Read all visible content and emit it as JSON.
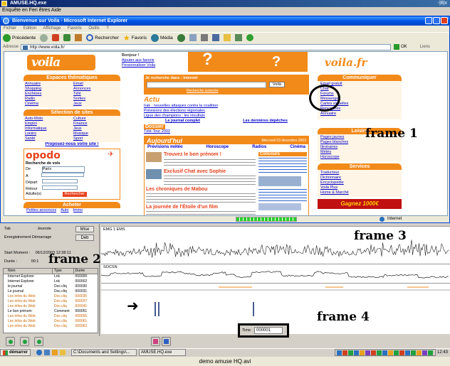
{
  "window": {
    "title": "AMUSE.HQ.exe",
    "menu": "Enquête en Fen êtres Aide",
    "win_ctrl": "-|8|x"
  },
  "browser": {
    "title": "Bienvenue sur Voila - Microsoft Internet Explorer",
    "menu": [
      "Fichier",
      "Edition",
      "Affichage",
      "Favoris",
      "Outils",
      "?"
    ],
    "toolbar": {
      "back": "Précédente",
      "search": "Rechercher",
      "favorites": "Favoris",
      "media": "Média"
    },
    "address_label": "Adresse",
    "address_value": "http://www.voila.fr/",
    "go_label": "OK",
    "links_label": "Liens"
  },
  "page": {
    "logo": "voila",
    "logo_right": "voila.fr",
    "top_links": [
      "Bonjour !",
      "Ajouter aux favoris",
      "Personnaliser Voila"
    ],
    "search_head": "Je recherche dans : Internet",
    "search_button": "Voilà",
    "advanced": "Recherche avancée",
    "actu_head": "Actu",
    "actu_items": [
      "Irak : nouvelles attaques contre la coalition",
      "Prévisions des élections régionales",
      "Ligue des champions : les résultats",
      "Le journal complet",
      "Les dernières dépêches"
    ],
    "dossier_head": "Dossier",
    "dossier_item": "Télé-Tour 2002",
    "aujourdhui_head": "Aujourd'hui",
    "aujourdhui_date": "Mercredi 03 décembre 2003",
    "aujourdhui_tabs": [
      "Prévisions météo",
      "Horoscope",
      "Radios",
      "Cinéma"
    ],
    "trouve_title": "Trouvez le bon prénom !",
    "chat_title": "Exclusif Chat avec Sophie",
    "lecteur_title": "Les chroniques de Mabou",
    "journal_title": "La journée de l'Étoile d'un film",
    "concours_title": "Concours",
    "left_head": "Espaces thématiques",
    "left_items": [
      "Annuaire",
      "Email",
      "Shopping",
      "Annonces",
      "Enchères",
      "Télé",
      "Radio",
      "Sorties",
      "Cinéma",
      "Jeux"
    ],
    "selection_head": "Sélection de sites",
    "selection_items": [
      "Auto-Moto",
      "Culture",
      "Emploi",
      "Finance",
      "Informatique",
      "Jeux",
      "Loisirs",
      "Musique",
      "Santé",
      "Sport"
    ],
    "proposez": "Proposez-nous votre site !",
    "opodo": "opodo",
    "opodo_sub": "Recherche de vols",
    "opodo_de": "De",
    "opodo_a": "A",
    "opodo_from": "Paris",
    "opodo_depart": "Départ",
    "opodo_retour": "Retour",
    "opodo_adultes": "Adulte(s)",
    "opodo_button": "Rechercher",
    "acheter_head": "Acheter",
    "acheter_links": [
      "Petites annonces",
      "Auto",
      "Immo"
    ],
    "right_head": "Communiquer",
    "right_items": [
      "Email gratuit",
      "Chat",
      "Forums",
      "Messenger",
      "Cartes virtuelles",
      "Rencontres",
      "Annuaire",
      "Vous parlez"
    ],
    "loisirs_head": "Loisirs",
    "loisirs_items": [
      "Pages jaunes",
      "Pages blanches",
      "Itinéraires",
      "Météo",
      "Horoscope",
      "Jeux"
    ],
    "services_head": "Services",
    "services_items": [
      "Traducteur",
      "Dictionnaire",
      "Encyclopédie",
      "Voilà Plus",
      "Home & Marché"
    ],
    "gagnez": "Gagnez 1000€",
    "status_left": "",
    "status_right": "Internet"
  },
  "frame2": {
    "label": "frame 2",
    "tab_label": "Tab",
    "tab_value": "Jeunote",
    "tab_button": "Mise",
    "enreg_label": "Enregistrement Démarrage",
    "enreg_button": "Déb",
    "start_label": "Start Moment :",
    "start_value": "06/12/2003 12:38:11",
    "duree_label": "Durée :",
    "duree_value": "00:1",
    "columns": [
      "Nom",
      "Type",
      "Durée"
    ],
    "rows": [
      {
        "name": "Internet Explorer",
        "type": "Lnk",
        "time": "000000",
        "color": "#000000"
      },
      {
        "name": "Internet Explorer",
        "type": "Lnk",
        "time": "000002",
        "color": "#000000"
      },
      {
        "name": "le journal",
        "type": "Doc.cliq",
        "time": "000030",
        "color": "#000000"
      },
      {
        "name": "Le journal",
        "type": "Doc.cliq",
        "time": "000031",
        "color": "#000000"
      },
      {
        "name": "Les infos du Web",
        "type": "Doc.cliq",
        "time": "000035",
        "color": "#cc6600"
      },
      {
        "name": "Les infos du Web",
        "type": "Doc.cliq",
        "time": "000037",
        "color": "#cc6600"
      },
      {
        "name": "Les infos du Web",
        "type": "Doc.cliq",
        "time": "000041",
        "color": "#cc6600"
      },
      {
        "name": "Le bon prénom",
        "type": "Comment",
        "time": "000051",
        "color": "#000000"
      },
      {
        "name": "Les infos du Web",
        "type": "Doc.cliq",
        "time": "000055",
        "color": "#cc6600"
      },
      {
        "name": "Les infos du Web",
        "type": "Doc.cliq",
        "time": "000061",
        "color": "#cc6600"
      },
      {
        "name": "Les infos du Web",
        "type": "Doc.cliq",
        "time": "000063",
        "color": "#cc6600"
      }
    ]
  },
  "frame1": {
    "label": "frame 1"
  },
  "frame3": {
    "label": "frame 3",
    "track1": "EMG 1 EMS",
    "track2": "SOCSN"
  },
  "frame4": {
    "label": "frame 4",
    "timer_label": "Time",
    "timer_value": "000001"
  },
  "taskbar": {
    "start": "démarrer",
    "items": [
      "C:\\Documents and Settings\\...",
      "AMUSE.HQ.exe"
    ],
    "clock": "12:43"
  },
  "caption": "demo amuse HQ.avi",
  "colors": {
    "orange": "#f28a1a",
    "voila_red": "#e8401c",
    "xp_blue": "#0054e3",
    "selection_blue": "#0a246a",
    "black": "#000000"
  }
}
